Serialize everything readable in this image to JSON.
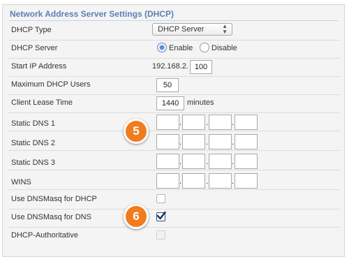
{
  "section": {
    "title": "Network Address Server Settings (DHCP)"
  },
  "dhcp_type": {
    "label": "DHCP Type",
    "value": "DHCP Server"
  },
  "dhcp_server": {
    "label": "DHCP Server",
    "enable_label": "Enable",
    "disable_label": "Disable",
    "selected": "Enable"
  },
  "start_ip": {
    "label": "Start IP Address",
    "prefix": "192.168.2.",
    "value": "100"
  },
  "max_users": {
    "label": "Maximum DHCP Users",
    "value": "50"
  },
  "lease_time": {
    "label": "Client Lease Time",
    "value": "1440",
    "unit": "minutes"
  },
  "static_dns1": {
    "label": "Static DNS 1",
    "octets": [
      "",
      "",
      "",
      ""
    ]
  },
  "static_dns2": {
    "label": "Static DNS 2",
    "octets": [
      "",
      "",
      "",
      ""
    ]
  },
  "static_dns3": {
    "label": "Static DNS 3",
    "octets": [
      "",
      "",
      "",
      ""
    ]
  },
  "wins": {
    "label": "WINS",
    "octets": [
      "",
      "",
      "",
      ""
    ]
  },
  "dnsmasq_dhcp": {
    "label": "Use DNSMasq for DHCP",
    "checked": false
  },
  "dnsmasq_dns": {
    "label": "Use DNSMasq for DNS",
    "checked": true
  },
  "dhcp_authoritative": {
    "label": "DHCP-Authoritative",
    "checked": false
  },
  "callouts": [
    "5",
    "6"
  ],
  "colors": {
    "accent": "#5c7fb5",
    "callout": "#f07c1e"
  }
}
